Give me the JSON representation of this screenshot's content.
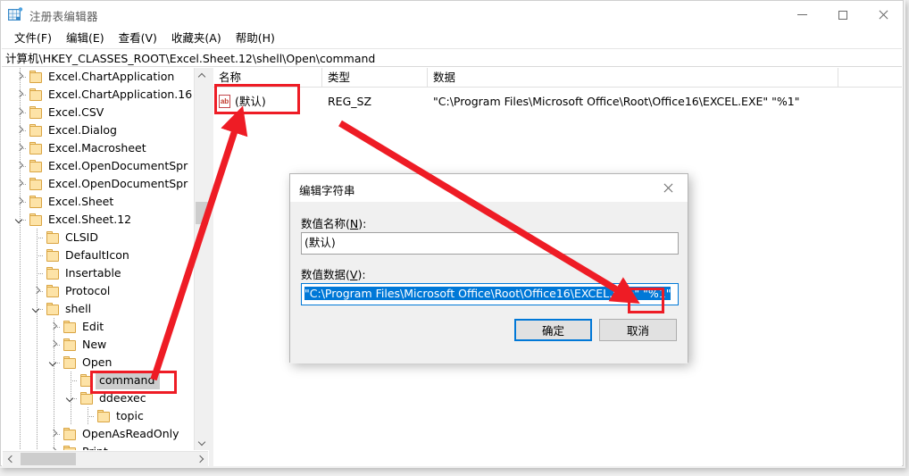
{
  "window": {
    "title": "注册表编辑器",
    "icon": "registry-editor-icon",
    "controls": {
      "minimize": "minimize-icon",
      "maximize": "maximize-icon",
      "close": "close-icon"
    }
  },
  "menubar": {
    "items": [
      {
        "label": "文件(F)"
      },
      {
        "label": "编辑(E)"
      },
      {
        "label": "查看(V)"
      },
      {
        "label": "收藏夹(A)"
      },
      {
        "label": "帮助(H)"
      }
    ]
  },
  "address": {
    "path": "计算机\\HKEY_CLASSES_ROOT\\Excel.Sheet.12\\shell\\Open\\command"
  },
  "tree": {
    "items": [
      {
        "label": "Excel.ChartApplication",
        "depth": 1,
        "expander": "collapsed",
        "selected": false
      },
      {
        "label": "Excel.ChartApplication.16",
        "depth": 1,
        "expander": "collapsed",
        "selected": false
      },
      {
        "label": "Excel.CSV",
        "depth": 1,
        "expander": "collapsed",
        "selected": false
      },
      {
        "label": "Excel.Dialog",
        "depth": 1,
        "expander": "collapsed",
        "selected": false
      },
      {
        "label": "Excel.Macrosheet",
        "depth": 1,
        "expander": "collapsed",
        "selected": false
      },
      {
        "label": "Excel.OpenDocumentSpr",
        "depth": 1,
        "expander": "collapsed",
        "selected": false
      },
      {
        "label": "Excel.OpenDocumentSpr",
        "depth": 1,
        "expander": "collapsed",
        "selected": false
      },
      {
        "label": "Excel.Sheet",
        "depth": 1,
        "expander": "collapsed",
        "selected": false
      },
      {
        "label": "Excel.Sheet.12",
        "depth": 1,
        "expander": "expanded",
        "selected": false
      },
      {
        "label": "CLSID",
        "depth": 2,
        "expander": "none",
        "selected": false
      },
      {
        "label": "DefaultIcon",
        "depth": 2,
        "expander": "none",
        "selected": false
      },
      {
        "label": "Insertable",
        "depth": 2,
        "expander": "none",
        "selected": false
      },
      {
        "label": "Protocol",
        "depth": 2,
        "expander": "collapsed",
        "selected": false
      },
      {
        "label": "shell",
        "depth": 2,
        "expander": "expanded",
        "selected": false
      },
      {
        "label": "Edit",
        "depth": 3,
        "expander": "collapsed",
        "selected": false
      },
      {
        "label": "New",
        "depth": 3,
        "expander": "collapsed",
        "selected": false
      },
      {
        "label": "Open",
        "depth": 3,
        "expander": "expanded",
        "selected": false
      },
      {
        "label": "command",
        "depth": 4,
        "expander": "none",
        "selected": true
      },
      {
        "label": "ddeexec",
        "depth": 4,
        "expander": "expanded",
        "selected": false
      },
      {
        "label": "topic",
        "depth": 5,
        "expander": "none",
        "selected": false
      },
      {
        "label": "OpenAsReadOnly",
        "depth": 3,
        "expander": "collapsed",
        "selected": false
      },
      {
        "label": "Print",
        "depth": 3,
        "expander": "collapsed",
        "selected": false
      }
    ]
  },
  "listview": {
    "columns": [
      {
        "label": "名称"
      },
      {
        "label": "类型"
      },
      {
        "label": "数据"
      }
    ],
    "rows": [
      {
        "icon": "string-value-icon",
        "name": "(默认)",
        "type": "REG_SZ",
        "data": "\"C:\\Program Files\\Microsoft Office\\Root\\Office16\\EXCEL.EXE\" \"%1\""
      }
    ]
  },
  "dialog": {
    "title": "编辑字符串",
    "close_icon": "close-icon",
    "name_label_prefix": "数值名称(",
    "name_label_key": "N",
    "name_label_suffix": "):",
    "name_value": "(默认)",
    "data_label_prefix": "数值数据(",
    "data_label_key": "V",
    "data_label_suffix": "):",
    "data_value_selected": "\"C:\\Program Files\\Microsoft Office\\Root\\Office16\\EXCEL.EXE\" \"%1\"",
    "ok_label": "确定",
    "cancel_label": "取消"
  },
  "annotations": {
    "accent_color": "#ee1c25",
    "highlight_boxes": [
      {
        "name": "default-value-row-highlight"
      },
      {
        "name": "percent-one-token-highlight"
      },
      {
        "name": "command-key-highlight"
      }
    ],
    "arrows": [
      {
        "name": "arrow-command-to-default-value"
      },
      {
        "name": "arrow-data-to-percent-one"
      }
    ]
  },
  "scrollbars": {
    "tree_vertical": "tree-vertical-scrollbar",
    "tree_horizontal": "tree-horizontal-scrollbar"
  }
}
